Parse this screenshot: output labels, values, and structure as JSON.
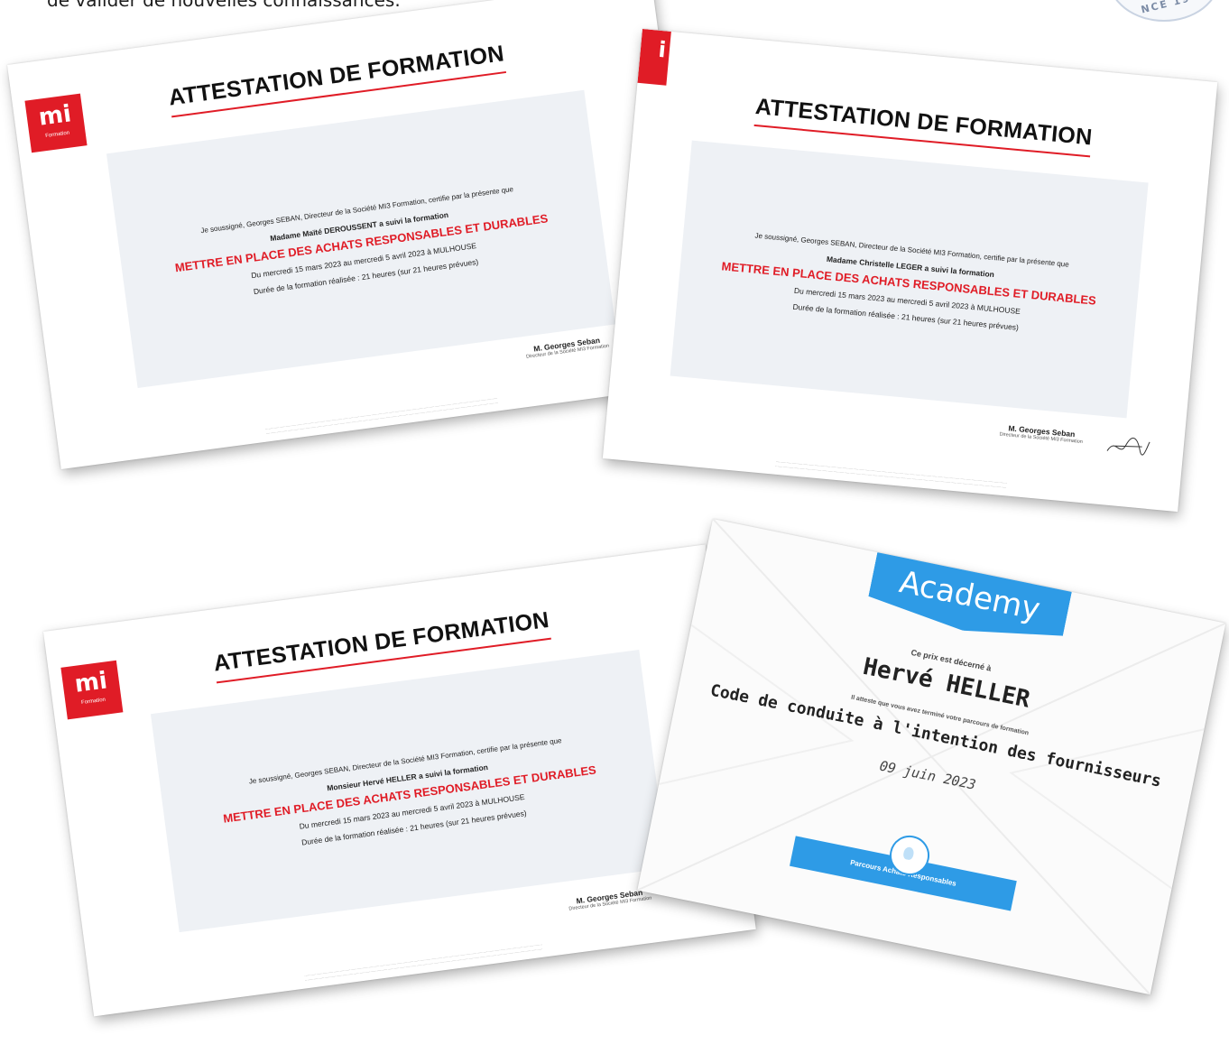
{
  "intro_text": "de valider de nouvelles connaissances.",
  "seal_text": "NCE 19",
  "certificates": [
    {
      "logo_text": "mi",
      "logo_sub": "Formation",
      "title": "ATTESTATION DE FORMATION",
      "intro": "Je soussigné, Georges SEBAN, Directeur de la Société MI3 Formation, certifie par la présente que",
      "trainee": "Madame Maïté DEROUSSENT a suivi la formation",
      "course": "METTRE EN PLACE DES ACHATS RESPONSABLES ET DURABLES",
      "dates": "Du mercredi 15 mars 2023 au mercredi 5 avril 2023 à MULHOUSE",
      "duration": "Durée de la formation réalisée : 21 heures (sur 21 heures prévues)",
      "signatory": "M. Georges Seban",
      "signatory_role": "Directeur de la Société MI3 Formation"
    },
    {
      "logo_text": "i",
      "logo_sub": "",
      "title": "ATTESTATION DE FORMATION",
      "intro": "Je soussigné, Georges SEBAN, Directeur de la Société MI3 Formation, certifie par la présente que",
      "trainee": "Madame Christelle LEGER a suivi la formation",
      "course": "METTRE EN PLACE DES ACHATS RESPONSABLES ET DURABLES",
      "dates": "Du mercredi 15 mars 2023 au mercredi 5 avril 2023 à MULHOUSE",
      "duration": "Durée de la formation réalisée : 21 heures (sur 21 heures prévues)",
      "signatory": "M. Georges Seban",
      "signatory_role": "Directeur de la Société MI3 Formation"
    },
    {
      "logo_text": "mi",
      "logo_sub": "Formation",
      "title": "ATTESTATION DE FORMATION",
      "intro": "Je soussigné, Georges SEBAN, Directeur de la Société MI3 Formation, certifie par la présente que",
      "trainee": "Monsieur Hervé HELLER a suivi la formation",
      "course": "METTRE EN PLACE DES ACHATS RESPONSABLES ET DURABLES",
      "dates": "Du mercredi 15 mars 2023 au mercredi 5 avril 2023 à MULHOUSE",
      "duration": "Durée de la formation réalisée : 21 heures (sur 21 heures prévues)",
      "signatory": "M. Georges Seban",
      "signatory_role": "Directeur de la Société MI3 Formation"
    }
  ],
  "academy": {
    "brand": "Academy",
    "delivered_to": "Ce prix est décerné à",
    "recipient": "Hervé HELLER",
    "attest": "Il atteste que vous avez terminé votre parcours de formation",
    "course": "Code de conduite à l'intention des fournisseurs",
    "date": "09 juin 2023",
    "ribbon": "Parcours Achats Responsables"
  }
}
